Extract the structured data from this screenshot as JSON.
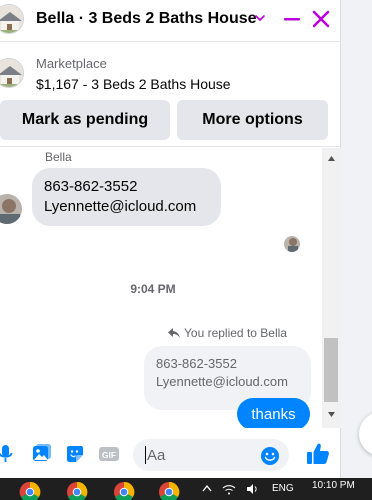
{
  "header": {
    "title": "Bella · 3 Beds 2 Baths House",
    "accent_color": "#bc00dd",
    "icons": [
      "chevron-down-icon",
      "minimize-icon",
      "close-icon"
    ]
  },
  "listing": {
    "source": "Marketplace",
    "title": "$1,167 - 3 Beds 2 Baths House"
  },
  "actions": {
    "pending_label": "Mark as pending",
    "more_label": "More options"
  },
  "conversation": {
    "sender_name": "Bella",
    "incoming": {
      "line1": "863-862-3552",
      "line2": "Lyennette@icloud.com"
    },
    "timestamp": "9:04 PM",
    "reply_indicator": "You replied to Bella",
    "quoted": {
      "line1": "863-862-3552",
      "line2": "Lyennette@icloud.com"
    },
    "outgoing": "thanks"
  },
  "composer": {
    "placeholder": "Aa",
    "icons": [
      "microphone-icon",
      "photo-icon",
      "sticker-icon",
      "gif-icon",
      "emoji-icon",
      "thumbs-up-icon"
    ]
  },
  "taskbar": {
    "language": "ENG",
    "time": "10:10 PM",
    "apps": [
      "chrome-icon",
      "chrome-icon",
      "chrome-icon",
      "chrome-icon"
    ]
  },
  "colors": {
    "messenger_blue": "#0084ff",
    "bubble_gray": "#e4e6eb",
    "text_secondary": "#65676b"
  }
}
